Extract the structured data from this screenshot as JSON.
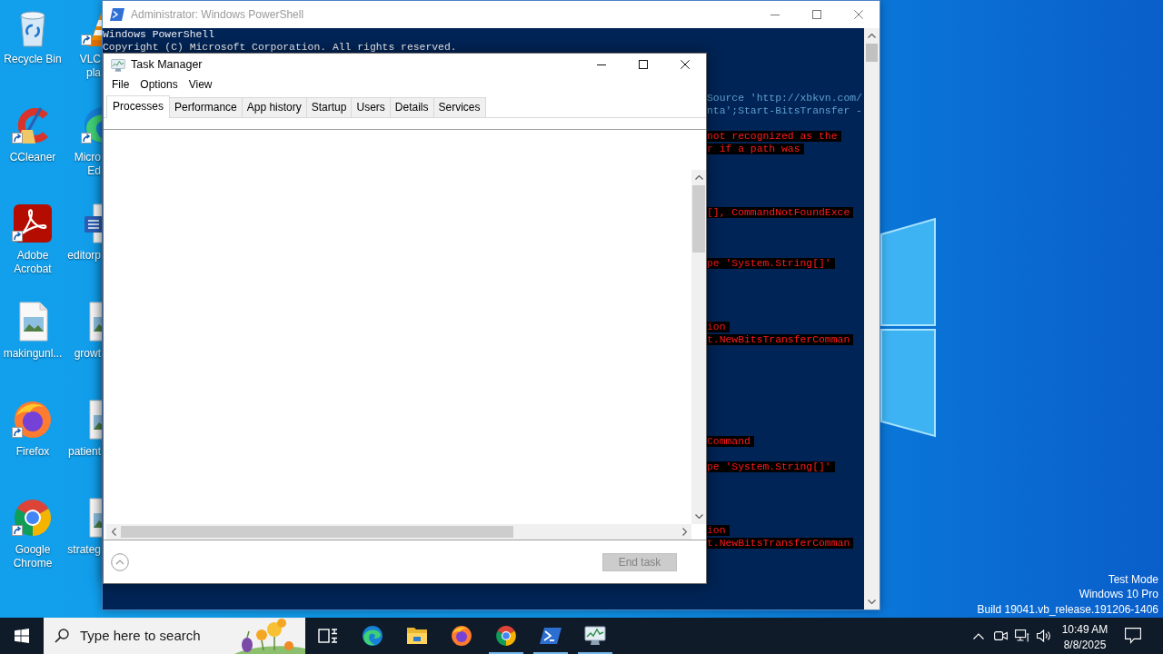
{
  "desktop": {
    "icon_columns": [
      [
        {
          "kind": "recycle-bin",
          "label": [
            "Recycle Bin"
          ],
          "shortcut": false
        },
        {
          "kind": "ccleaner",
          "label": [
            "CCleaner"
          ],
          "shortcut": true
        },
        {
          "kind": "acrobat",
          "label": [
            "Adobe",
            "Acrobat"
          ],
          "shortcut": true
        },
        {
          "kind": "image-file",
          "label": [
            "makingunl..."
          ],
          "shortcut": false
        },
        {
          "kind": "firefox",
          "label": [
            "Firefox"
          ],
          "shortcut": true
        },
        {
          "kind": "chrome",
          "label": [
            "Google",
            "Chrome"
          ],
          "shortcut": true
        }
      ],
      [
        {
          "kind": "vlc",
          "label": [
            "VLC",
            "pla"
          ],
          "shortcut": true
        },
        {
          "kind": "edge",
          "label": [
            "Micro",
            "Ed"
          ],
          "shortcut": true
        },
        {
          "kind": "word-doc",
          "label": [
            "editorp"
          ],
          "shortcut": false
        },
        {
          "kind": "image-file",
          "label": [
            "growt"
          ],
          "shortcut": false
        },
        {
          "kind": "image-file",
          "label": [
            "patient"
          ],
          "shortcut": false
        },
        {
          "kind": "image-file",
          "label": [
            "strateg"
          ],
          "shortcut": false
        }
      ]
    ],
    "system_info": [
      "Test Mode",
      "Windows 10 Pro",
      "Build 19041.vb_release.191206-1406"
    ]
  },
  "powershell_window": {
    "title": "Administrator: Windows PowerShell",
    "console": {
      "lines": [
        "Windows PowerShell",
        "Copyright (C) Microsoft Corporation. All rights reserved."
      ],
      "cut_lines": [
        {
          "kind": "covered"
        },
        {
          "kind": "covered"
        },
        {
          "kind": "covered"
        },
        {
          "kind": "command",
          "text": "Source 'http://xbkvn.com/"
        },
        {
          "kind": "command",
          "text": "nta';Start-BitsTransfer -"
        },
        {
          "kind": "covered"
        },
        {
          "kind": "error",
          "text": "not recognized as the"
        },
        {
          "kind": "error",
          "text": "r if a path was"
        },
        {
          "kind": "covered"
        },
        {
          "kind": "covered"
        },
        {
          "kind": "covered"
        },
        {
          "kind": "covered"
        },
        {
          "kind": "error",
          "text": "[], CommandNotFoundExce"
        },
        {
          "kind": "covered"
        },
        {
          "kind": "covered"
        },
        {
          "kind": "covered"
        },
        {
          "kind": "error",
          "text": "pe 'System.String[]'"
        },
        {
          "kind": "covered"
        },
        {
          "kind": "covered"
        },
        {
          "kind": "covered"
        },
        {
          "kind": "covered"
        },
        {
          "kind": "error",
          "text": "ion"
        },
        {
          "kind": "error",
          "text": "t.NewBitsTransferComman"
        },
        {
          "kind": "covered"
        },
        {
          "kind": "covered"
        },
        {
          "kind": "covered"
        },
        {
          "kind": "covered"
        },
        {
          "kind": "covered"
        },
        {
          "kind": "covered"
        },
        {
          "kind": "covered"
        },
        {
          "kind": "error",
          "text": "Command"
        },
        {
          "kind": "covered"
        },
        {
          "kind": "error",
          "text": "pe 'System.String[]'"
        },
        {
          "kind": "covered"
        },
        {
          "kind": "covered"
        },
        {
          "kind": "covered"
        },
        {
          "kind": "covered"
        },
        {
          "kind": "error",
          "text": "ion"
        },
        {
          "kind": "error",
          "text": "t.NewBitsTransferComman"
        }
      ]
    }
  },
  "task_manager": {
    "title": "Task Manager",
    "menu": [
      "File",
      "Options",
      "View"
    ],
    "tabs": [
      {
        "label": "Processes",
        "selected": true
      },
      {
        "label": "Performance",
        "selected": false
      },
      {
        "label": "App history",
        "selected": false
      },
      {
        "label": "Startup",
        "selected": false
      },
      {
        "label": "Users",
        "selected": false
      },
      {
        "label": "Details",
        "selected": false
      },
      {
        "label": "Services",
        "selected": false
      }
    ],
    "end_task": {
      "label": "End task",
      "disabled": true
    }
  },
  "taskbar": {
    "search": {
      "placeholder": "Type here to search"
    },
    "apps": [
      {
        "kind": "task-view",
        "running": false
      },
      {
        "kind": "edge",
        "running": false
      },
      {
        "kind": "file-explorer",
        "running": false
      },
      {
        "kind": "firefox",
        "running": false
      },
      {
        "kind": "chrome",
        "running": true
      },
      {
        "kind": "powershell",
        "running": true
      },
      {
        "kind": "task-manager",
        "running": true
      }
    ],
    "clock": {
      "time": "10:49 AM",
      "date": "8/8/2025"
    }
  }
}
